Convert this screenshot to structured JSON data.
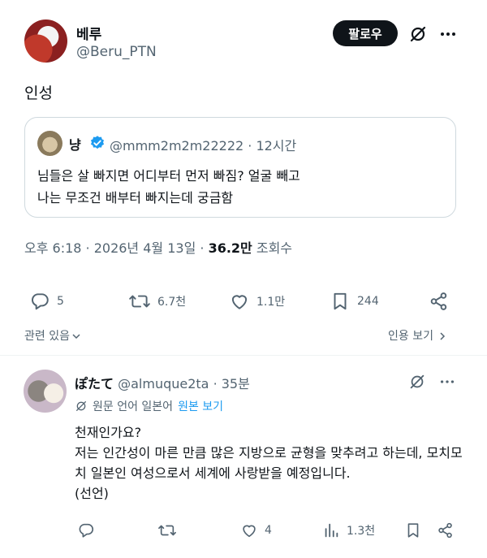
{
  "post": {
    "display_name": "베루",
    "handle": "@Beru_PTN",
    "follow_label": "팔로우",
    "text": "인성",
    "timestamp": "오후 6:18 · 2026년 4월 13일 · ",
    "views_count": "36.2만",
    "views_label": " 조회수"
  },
  "quote": {
    "display_name": "냥",
    "handle_time": "@mmm2m2m22222 · 12시간",
    "line1": "님들은 살 빠지면 어디부터 먼저 빠짐? 얼굴 빼고",
    "line2": "나는 무조건 배부터 빠지는데 궁금함"
  },
  "actions": {
    "replies": "5",
    "reposts": "6.7천",
    "likes": "1.1만",
    "bookmarks": "244"
  },
  "links": {
    "related": "관련 있음",
    "quotes": "인용 보기"
  },
  "reply": {
    "display_name": "ぽたて",
    "handle_time": " @almuque2ta · 35분",
    "original_lang": "원문 언어 일본어",
    "see_original": "원본 보기",
    "body": "천재인가요?\n저는 인간성이 마른 만큼 많은 지방으로 균형을 맞추려고 하는데, 모치모치 일본인 여성으로서 세계에 사랑받을 예정입니다.\n(선언)",
    "likes": "4",
    "views": "1.3천"
  },
  "colors": {
    "text": "#0f1419",
    "secondary": "#536471",
    "link": "#1d9bf0",
    "verified": "#1d9bf0"
  }
}
